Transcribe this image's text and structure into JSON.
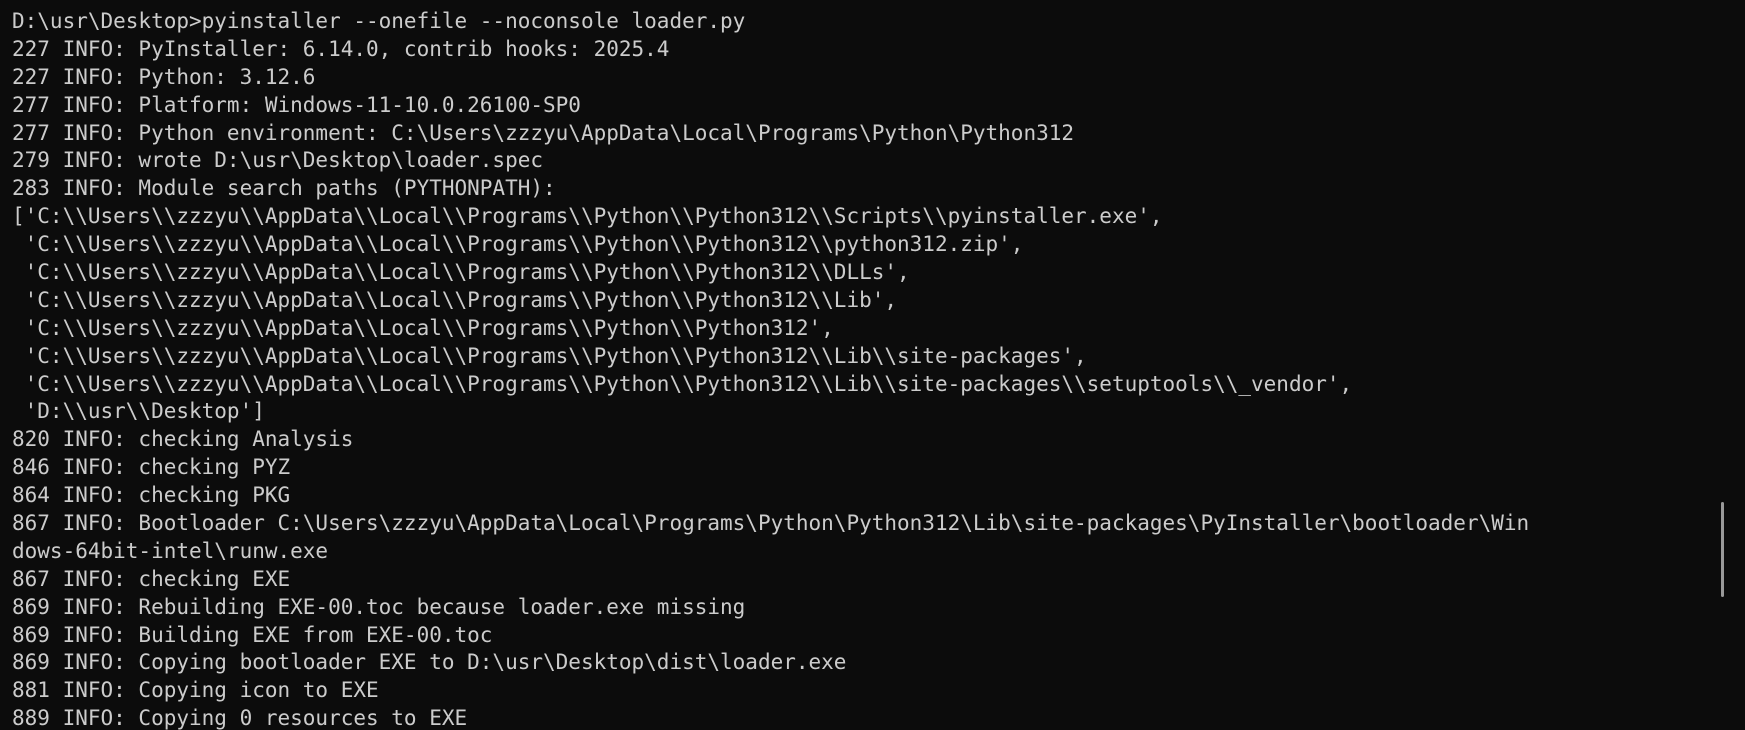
{
  "terminal": {
    "lines": [
      "D:\\usr\\Desktop>pyinstaller --onefile --noconsole loader.py",
      "227 INFO: PyInstaller: 6.14.0, contrib hooks: 2025.4",
      "227 INFO: Python: 3.12.6",
      "277 INFO: Platform: Windows-11-10.0.26100-SP0",
      "277 INFO: Python environment: C:\\Users\\zzzyu\\AppData\\Local\\Programs\\Python\\Python312",
      "279 INFO: wrote D:\\usr\\Desktop\\loader.spec",
      "283 INFO: Module search paths (PYTHONPATH):",
      "['C:\\\\Users\\\\zzzyu\\\\AppData\\\\Local\\\\Programs\\\\Python\\\\Python312\\\\Scripts\\\\pyinstaller.exe',",
      " 'C:\\\\Users\\\\zzzyu\\\\AppData\\\\Local\\\\Programs\\\\Python\\\\Python312\\\\python312.zip',",
      " 'C:\\\\Users\\\\zzzyu\\\\AppData\\\\Local\\\\Programs\\\\Python\\\\Python312\\\\DLLs',",
      " 'C:\\\\Users\\\\zzzyu\\\\AppData\\\\Local\\\\Programs\\\\Python\\\\Python312\\\\Lib',",
      " 'C:\\\\Users\\\\zzzyu\\\\AppData\\\\Local\\\\Programs\\\\Python\\\\Python312',",
      " 'C:\\\\Users\\\\zzzyu\\\\AppData\\\\Local\\\\Programs\\\\Python\\\\Python312\\\\Lib\\\\site-packages',",
      " 'C:\\\\Users\\\\zzzyu\\\\AppData\\\\Local\\\\Programs\\\\Python\\\\Python312\\\\Lib\\\\site-packages\\\\setuptools\\\\_vendor',",
      " 'D:\\\\usr\\\\Desktop']",
      "820 INFO: checking Analysis",
      "846 INFO: checking PYZ",
      "864 INFO: checking PKG",
      "867 INFO: Bootloader C:\\Users\\zzzyu\\AppData\\Local\\Programs\\Python\\Python312\\Lib\\site-packages\\PyInstaller\\bootloader\\Win",
      "dows-64bit-intel\\runw.exe",
      "867 INFO: checking EXE",
      "869 INFO: Rebuilding EXE-00.toc because loader.exe missing",
      "869 INFO: Building EXE from EXE-00.toc",
      "869 INFO: Copying bootloader EXE to D:\\usr\\Desktop\\dist\\loader.exe",
      "881 INFO: Copying icon to EXE",
      "889 INFO: Copying 0 resources to EXE"
    ],
    "colors": {
      "background": "#0c0c0c",
      "text": "#cccccc",
      "scrollbar": "#9a9a9a"
    }
  }
}
